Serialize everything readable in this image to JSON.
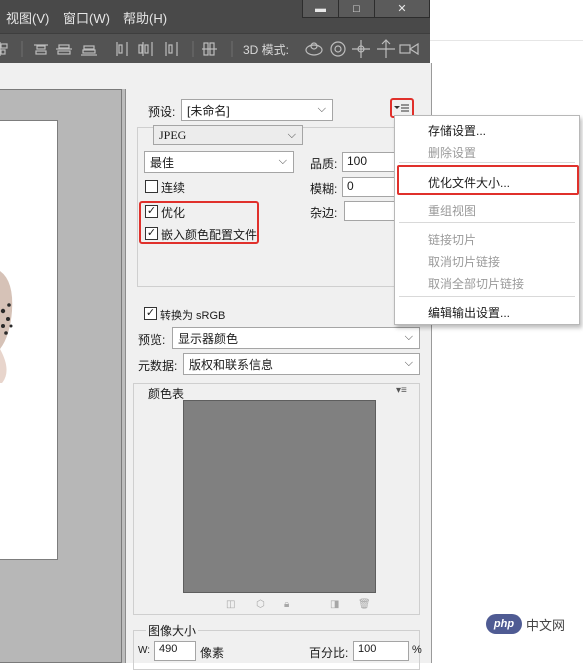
{
  "app": {
    "menus": [
      "视图(V)",
      "窗口(W)",
      "帮助(H)"
    ],
    "window_controls": {
      "minimize": "▬",
      "maximize": "□",
      "close": "✕"
    },
    "mode_3d_label": "3D 模式:"
  },
  "settings": {
    "preset_label": "预设:",
    "preset_value": "[未命名]",
    "format_value": "JPEG",
    "quality_preset_value": "最佳",
    "quality_label": "品质:",
    "quality_value": "100",
    "blur_label": "模糊:",
    "blur_value": "0",
    "matte_label": "杂边:",
    "matte_value": "",
    "progressive_label": "连续",
    "progressive_checked": false,
    "optimized_label": "优化",
    "optimized_checked": true,
    "embed_profile_label": "嵌入颜色配置文件",
    "embed_profile_checked": true,
    "convert_srgb_label": "转换为 sRGB",
    "convert_srgb_checked": true,
    "preview_label": "预览:",
    "preview_value": "显示器颜色",
    "metadata_label": "元数据:",
    "metadata_value": "版权和联系信息",
    "color_table_label": "颜色表",
    "image_size_label": "图像大小",
    "width_label": "W:",
    "width_value": "490",
    "width_unit": "像素",
    "percent_label": "百分比:",
    "percent_value": "100",
    "percent_unit": "%"
  },
  "dropdown_menu": {
    "items": [
      {
        "label": "存储设置...",
        "enabled": true
      },
      {
        "label": "删除设置",
        "enabled": false
      },
      {
        "label": "优化文件大小...",
        "enabled": true,
        "highlighted": true
      },
      {
        "label": "重组视图",
        "enabled": false
      },
      {
        "label": "链接切片",
        "enabled": false
      },
      {
        "label": "取消切片链接",
        "enabled": false
      },
      {
        "label": "取消全部切片链接",
        "enabled": false
      },
      {
        "label": "编辑输出设置...",
        "enabled": true
      }
    ]
  },
  "watermark": {
    "logo": "php",
    "text": "中文网"
  },
  "colors": {
    "highlight": "#e0302b",
    "chrome_dark": "#494949",
    "swatch": "#808080"
  }
}
